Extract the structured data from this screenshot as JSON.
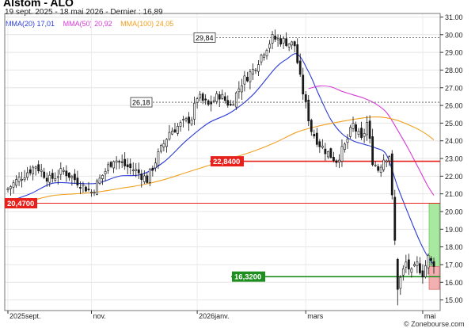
{
  "title": "Alstom - ALO",
  "subtitle": "19 sept. 2025 - 18 mai 2026 - Dernier : 16,89",
  "source": "© Zonebourse.com",
  "legend": [
    {
      "label": "MMA(20)",
      "value": "17,01",
      "color": "#2a3bd6"
    },
    {
      "label": "MMA(50)",
      "value": "20,92",
      "color": "#d63ad6"
    },
    {
      "label": "MMA(100)",
      "value": "24,05",
      "color": "#f0a020"
    }
  ],
  "chart_data": {
    "type": "candlestick",
    "ylim": [
      14.4,
      31.2
    ],
    "y_ticks": [
      15,
      16,
      17,
      18,
      19,
      20,
      21,
      22,
      23,
      24,
      25,
      26,
      27,
      28,
      29,
      30,
      31
    ],
    "y_tick_labels": [
      "15.00",
      "16.00",
      "17.00",
      "18.00",
      "19.00",
      "20.00",
      "21.00",
      "22.00",
      "23.00",
      "24.00",
      "25.00",
      "26.00",
      "27.00",
      "28.00",
      "29.00",
      "30.00",
      "31.00"
    ],
    "x_labels": [
      {
        "label": "2025sept.",
        "index": 0
      },
      {
        "label": "nov.",
        "index": 30
      },
      {
        "label": "2026janv.",
        "index": 68
      },
      {
        "label": "mars",
        "index": 107
      },
      {
        "label": "mai",
        "index": 149
      }
    ],
    "candle_count": 154,
    "horizontal_levels": [
      {
        "value": 20.47,
        "label": "20,4700",
        "color": "#e8201c"
      },
      {
        "value": 22.84,
        "label": "22,8400",
        "color": "#e8201c"
      },
      {
        "value": 16.32,
        "label": "16,3200",
        "color": "#1e8f1e"
      }
    ],
    "dashed_levels": [
      {
        "value": 29.84,
        "label": "29,84"
      },
      {
        "value": 26.18,
        "label": "26,18"
      }
    ],
    "close_anchors": [
      [
        0,
        21.3
      ],
      [
        5,
        22.0
      ],
      [
        10,
        22.6
      ],
      [
        15,
        21.8
      ],
      [
        20,
        22.3
      ],
      [
        25,
        21.7
      ],
      [
        30,
        21.1
      ],
      [
        35,
        22.3
      ],
      [
        38,
        23.0
      ],
      [
        42,
        22.6
      ],
      [
        46,
        22.3
      ],
      [
        50,
        21.8
      ],
      [
        54,
        23.2
      ],
      [
        58,
        24.5
      ],
      [
        62,
        24.9
      ],
      [
        66,
        25.3
      ],
      [
        68,
        26.5
      ],
      [
        72,
        26.0
      ],
      [
        76,
        26.6
      ],
      [
        80,
        26.0
      ],
      [
        84,
        27.3
      ],
      [
        88,
        28.0
      ],
      [
        92,
        29.1
      ],
      [
        95,
        29.8
      ],
      [
        100,
        29.6
      ],
      [
        103,
        29.4
      ],
      [
        105,
        27.5
      ],
      [
        107,
        26.0
      ],
      [
        109,
        24.6
      ],
      [
        112,
        23.8
      ],
      [
        115,
        23.3
      ],
      [
        118,
        22.9
      ],
      [
        121,
        23.7
      ],
      [
        124,
        24.9
      ],
      [
        127,
        24.0
      ],
      [
        129,
        25.0
      ],
      [
        131,
        22.9
      ],
      [
        133,
        22.4
      ],
      [
        135,
        23.0
      ],
      [
        137,
        23.2
      ],
      [
        139,
        18.3
      ],
      [
        140,
        15.1
      ],
      [
        141,
        16.2
      ],
      [
        143,
        17.1
      ],
      [
        145,
        16.5
      ],
      [
        147,
        17.0
      ],
      [
        149,
        16.5
      ],
      [
        151,
        17.4
      ],
      [
        153,
        16.89
      ]
    ],
    "moving_averages": [
      {
        "name": "MMA(20)",
        "color": "#2a3bd6",
        "points": [
          [
            0,
            20.55
          ],
          [
            8,
            21.0
          ],
          [
            16,
            21.6
          ],
          [
            24,
            21.6
          ],
          [
            32,
            21.6
          ],
          [
            40,
            22.0
          ],
          [
            48,
            22.1
          ],
          [
            56,
            22.8
          ],
          [
            64,
            24.0
          ],
          [
            72,
            25.0
          ],
          [
            80,
            25.6
          ],
          [
            88,
            26.6
          ],
          [
            96,
            28.1
          ],
          [
            100,
            28.6
          ],
          [
            104,
            28.9
          ],
          [
            108,
            27.9
          ],
          [
            112,
            26.5
          ],
          [
            116,
            25.2
          ],
          [
            120,
            24.4
          ],
          [
            124,
            24.0
          ],
          [
            128,
            23.8
          ],
          [
            132,
            23.6
          ],
          [
            136,
            23.2
          ],
          [
            140,
            21.4
          ],
          [
            144,
            19.8
          ],
          [
            148,
            18.3
          ],
          [
            151,
            17.4
          ],
          [
            153,
            17.01
          ]
        ]
      },
      {
        "name": "MMA(50)",
        "color": "#d63ad6",
        "points": [
          [
            108,
            26.95
          ],
          [
            112,
            27.1
          ],
          [
            116,
            27.05
          ],
          [
            120,
            26.8
          ],
          [
            124,
            26.6
          ],
          [
            128,
            26.4
          ],
          [
            132,
            26.1
          ],
          [
            136,
            25.6
          ],
          [
            140,
            24.6
          ],
          [
            144,
            23.5
          ],
          [
            148,
            22.3
          ],
          [
            151,
            21.4
          ],
          [
            153,
            20.92
          ]
        ]
      },
      {
        "name": "MMA(100)",
        "color": "#f0a020",
        "points": [
          [
            0,
            20.3
          ],
          [
            8,
            20.6
          ],
          [
            16,
            20.9
          ],
          [
            24,
            21.0
          ],
          [
            32,
            21.1
          ],
          [
            40,
            21.3
          ],
          [
            48,
            21.5
          ],
          [
            56,
            21.8
          ],
          [
            64,
            22.2
          ],
          [
            72,
            22.6
          ],
          [
            80,
            23.0
          ],
          [
            88,
            23.4
          ],
          [
            96,
            23.9
          ],
          [
            104,
            24.5
          ],
          [
            112,
            24.85
          ],
          [
            120,
            25.1
          ],
          [
            128,
            25.3
          ],
          [
            132,
            25.35
          ],
          [
            136,
            25.3
          ],
          [
            140,
            25.15
          ],
          [
            144,
            24.9
          ],
          [
            148,
            24.6
          ],
          [
            151,
            24.3
          ],
          [
            153,
            24.05
          ]
        ]
      }
    ],
    "forecast_boxes": [
      {
        "type": "upside",
        "low": 16.89,
        "high": 20.47,
        "color": "#a8e8a0"
      },
      {
        "type": "downside",
        "low": 15.6,
        "high": 16.89,
        "color": "#f2b0b0"
      }
    ]
  }
}
